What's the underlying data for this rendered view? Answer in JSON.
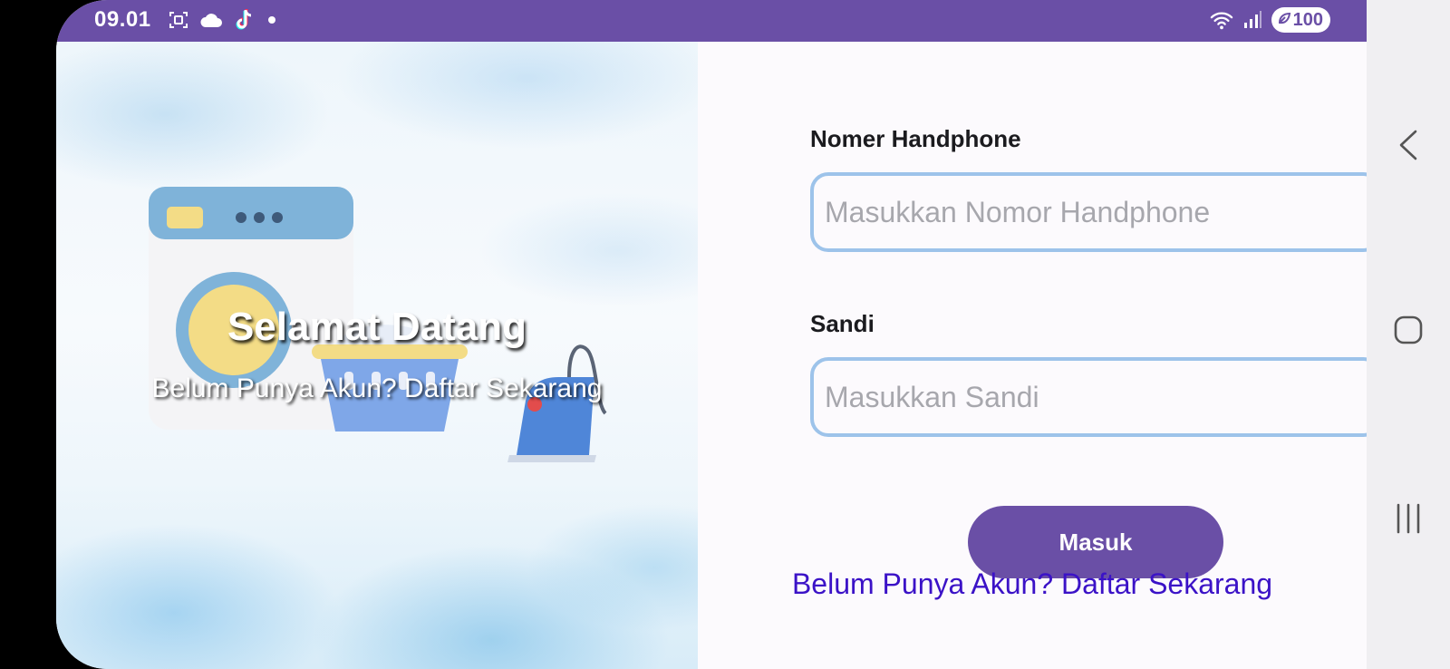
{
  "status_bar": {
    "time": "09.01",
    "battery": "100",
    "icons_left": [
      "screenshot-icon",
      "cloud-icon",
      "tiktok-icon",
      "notification-dot-icon"
    ],
    "icons_right": [
      "wifi-icon",
      "signal-icon",
      "battery-saver-icon"
    ]
  },
  "welcome": {
    "title": "Selamat Datang",
    "subtitle": "Belum Punya Akun? Daftar Sekarang"
  },
  "form": {
    "phone_label": "Nomer Handphone",
    "phone_placeholder": "Masukkan Nomor Handphone",
    "phone_value": "",
    "password_label": "Sandi",
    "password_placeholder": "Masukkan Sandi",
    "password_value": "",
    "login_button": "Masuk",
    "register_link": "Belum Punya Akun? Daftar Sekarang"
  },
  "nav": [
    "back-icon",
    "home-icon",
    "recents-icon"
  ],
  "colors": {
    "primary": "#6a4fa6",
    "input_border": "#9dc3ea",
    "link": "#3b12c7",
    "background": "#fcfafd"
  }
}
